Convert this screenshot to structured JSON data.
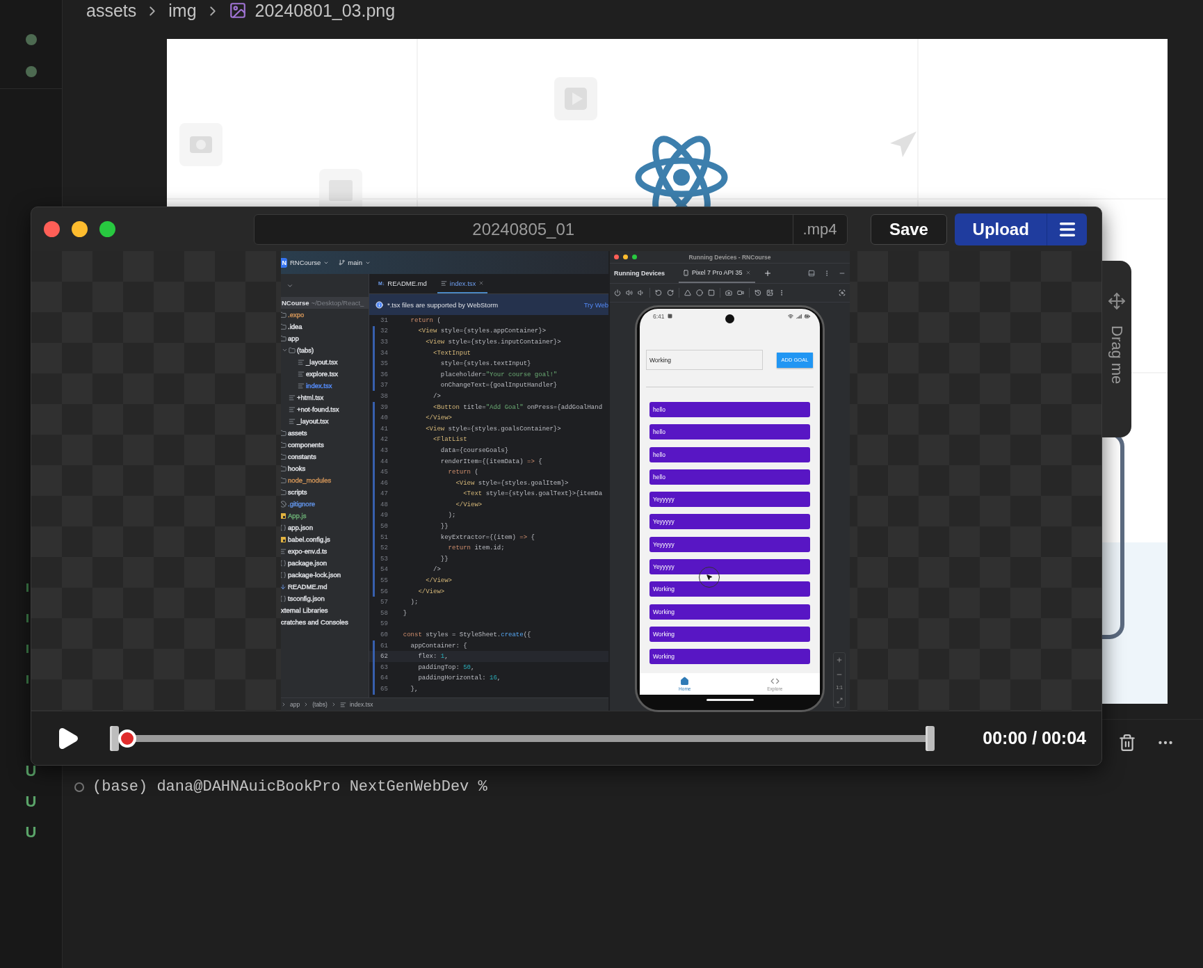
{
  "editor": {
    "breadcrumb": [
      "assets",
      "img",
      "20240801_03.png"
    ]
  },
  "gutter": {
    "badges": [
      "U",
      "U",
      "U"
    ]
  },
  "terminal": {
    "prompt": "(base) dana@DAHNAuicBookPro NextGenWebDev %"
  },
  "recorder": {
    "filename": "20240805_01",
    "extension": ".mp4",
    "save": "Save",
    "upload": "Upload",
    "drag_label": "Drag me",
    "playback": {
      "level": 0,
      "time": "00:00 / 00:04"
    },
    "frame": {
      "ide": {
        "project_badge": "N",
        "project": "RNCourse",
        "branch": "main",
        "tabs": [
          {
            "badge": "M↓",
            "label": "README.md",
            "selected": false
          },
          {
            "label": "index.tsx",
            "selected": true
          }
        ],
        "notice": "*.tsx files are supported by WebStorm",
        "notice_action": "Try Web",
        "tree_root": {
          "name": "NCourse",
          "path": "~/Desktop/React_"
        },
        "tree": [
          {
            "name": ".expo",
            "kind": "folder",
            "color": "#c98f56"
          },
          {
            "name": ".idea",
            "kind": "folder",
            "color": "#dfe1e5"
          },
          {
            "name": "app",
            "kind": "folder",
            "color": "#dfe1e5",
            "children": [
              {
                "name": "(tabs)",
                "kind": "folder",
                "color": "#dfe1e5",
                "expanded": true,
                "children": [
                  {
                    "name": "_layout.tsx",
                    "kind": "file",
                    "color": "#dfe1e5"
                  },
                  {
                    "name": "explore.tsx",
                    "kind": "file",
                    "color": "#dfe1e5"
                  },
                  {
                    "name": "index.tsx",
                    "kind": "file",
                    "color": "#548af7"
                  }
                ]
              },
              {
                "name": "+html.tsx",
                "kind": "file",
                "color": "#dfe1e5"
              },
              {
                "name": "+not-found.tsx",
                "kind": "file",
                "color": "#dfe1e5"
              },
              {
                "name": "_layout.tsx",
                "kind": "file",
                "color": "#dfe1e5"
              }
            ]
          },
          {
            "name": "assets",
            "kind": "folder",
            "color": "#dfe1e5"
          },
          {
            "name": "components",
            "kind": "folder",
            "color": "#dfe1e5"
          },
          {
            "name": "constants",
            "kind": "folder",
            "color": "#dfe1e5"
          },
          {
            "name": "hooks",
            "kind": "folder",
            "color": "#dfe1e5"
          },
          {
            "name": "node_modules",
            "kind": "folder",
            "color": "#c98f56"
          },
          {
            "name": "scripts",
            "kind": "folder",
            "color": "#dfe1e5"
          },
          {
            "name": ".gitignore",
            "kind": "ignore",
            "color": "#5f8fe0"
          },
          {
            "name": "App.js",
            "kind": "js",
            "color": "#6aab73"
          },
          {
            "name": "app.json",
            "kind": "json",
            "color": "#dfe1e5"
          },
          {
            "name": "babel.config.js",
            "kind": "js",
            "color": "#dfe1e5"
          },
          {
            "name": "expo-env.d.ts",
            "kind": "file",
            "color": "#dfe1e5"
          },
          {
            "name": "package.json",
            "kind": "json",
            "color": "#dfe1e5"
          },
          {
            "name": "package-lock.json",
            "kind": "json",
            "color": "#dfe1e5"
          },
          {
            "name": "README.md",
            "kind": "md",
            "color": "#dfe1e5"
          },
          {
            "name": "tsconfig.json",
            "kind": "json",
            "color": "#dfe1e5"
          },
          {
            "name": "xternal Libraries",
            "kind": "library",
            "color": "#dfe1e5"
          },
          {
            "name": "cratches and Consoles",
            "kind": "library",
            "color": "#dfe1e5"
          }
        ],
        "code": [
          {
            "number": "31",
            "changed": false,
            "current": false,
            "tokens": [
              {
                "kind": "keyword",
                "text": "    return"
              },
              {
                "kind": "plain",
                "text": " ("
              }
            ]
          },
          {
            "number": "32",
            "changed": true,
            "current": false,
            "tokens": [
              {
                "kind": "tag",
                "text": "      <View"
              },
              {
                "kind": "plain",
                "text": " style={styles.appContainer}>"
              }
            ]
          },
          {
            "number": "33",
            "changed": true,
            "current": false,
            "tokens": [
              {
                "kind": "tag",
                "text": "        <View"
              },
              {
                "kind": "plain",
                "text": " style={styles.inputContainer}>"
              }
            ]
          },
          {
            "number": "34",
            "changed": true,
            "current": false,
            "tokens": [
              {
                "kind": "tag",
                "text": "          <TextInput"
              }
            ]
          },
          {
            "number": "35",
            "changed": true,
            "current": false,
            "tokens": [
              {
                "kind": "plain",
                "text": "            style={styles.textInput}"
              }
            ]
          },
          {
            "number": "36",
            "changed": true,
            "current": false,
            "tokens": [
              {
                "kind": "plain",
                "text": "            placeholder="
              },
              {
                "kind": "string",
                "text": "\"Your course goal!\""
              }
            ]
          },
          {
            "number": "37",
            "changed": true,
            "current": false,
            "tokens": [
              {
                "kind": "plain",
                "text": "            onChangeText={goalInputHandler}"
              }
            ]
          },
          {
            "number": "38",
            "changed": false,
            "current": false,
            "tokens": [
              {
                "kind": "plain",
                "text": "          />"
              }
            ]
          },
          {
            "number": "39",
            "changed": true,
            "current": false,
            "tokens": [
              {
                "kind": "tag",
                "text": "          <Button"
              },
              {
                "kind": "plain",
                "text": " title="
              },
              {
                "kind": "string",
                "text": "\"Add Goal\""
              },
              {
                "kind": "plain",
                "text": " onPress={addGoalHand"
              }
            ]
          },
          {
            "number": "40",
            "changed": true,
            "current": false,
            "tokens": [
              {
                "kind": "tag",
                "text": "        </View>"
              }
            ]
          },
          {
            "number": "41",
            "changed": true,
            "current": false,
            "tokens": [
              {
                "kind": "tag",
                "text": "        <View"
              },
              {
                "kind": "plain",
                "text": " style={styles.goalsContainer}>"
              }
            ]
          },
          {
            "number": "42",
            "changed": true,
            "current": false,
            "tokens": [
              {
                "kind": "tag",
                "text": "          <FlatList"
              }
            ]
          },
          {
            "number": "43",
            "changed": true,
            "current": false,
            "tokens": [
              {
                "kind": "plain",
                "text": "            data={courseGoals}"
              }
            ]
          },
          {
            "number": "44",
            "changed": true,
            "current": false,
            "tokens": [
              {
                "kind": "plain",
                "text": "            renderItem={(itemData) "
              },
              {
                "kind": "keyword",
                "text": "=>"
              },
              {
                "kind": "plain",
                "text": " {"
              }
            ]
          },
          {
            "number": "45",
            "changed": true,
            "current": false,
            "tokens": [
              {
                "kind": "keyword",
                "text": "              return"
              },
              {
                "kind": "plain",
                "text": " ("
              }
            ]
          },
          {
            "number": "46",
            "changed": true,
            "current": false,
            "tokens": [
              {
                "kind": "tag",
                "text": "                <View"
              },
              {
                "kind": "plain",
                "text": " style={styles.goalItem}>"
              }
            ]
          },
          {
            "number": "47",
            "changed": true,
            "current": false,
            "tokens": [
              {
                "kind": "tag",
                "text": "                  <Text"
              },
              {
                "kind": "plain",
                "text": " style={styles.goalText}>{itemDa"
              }
            ]
          },
          {
            "number": "48",
            "changed": true,
            "current": false,
            "tokens": [
              {
                "kind": "tag",
                "text": "                </View>"
              }
            ]
          },
          {
            "number": "49",
            "changed": true,
            "current": false,
            "tokens": [
              {
                "kind": "plain",
                "text": "              );"
              }
            ]
          },
          {
            "number": "50",
            "changed": true,
            "current": false,
            "tokens": [
              {
                "kind": "plain",
                "text": "            }}"
              }
            ]
          },
          {
            "number": "51",
            "changed": true,
            "current": false,
            "tokens": [
              {
                "kind": "plain",
                "text": "            keyExtractor={(item) "
              },
              {
                "kind": "keyword",
                "text": "=>"
              },
              {
                "kind": "plain",
                "text": " {"
              }
            ]
          },
          {
            "number": "52",
            "changed": true,
            "current": false,
            "tokens": [
              {
                "kind": "keyword",
                "text": "              return"
              },
              {
                "kind": "plain",
                "text": " item.id;"
              }
            ]
          },
          {
            "number": "53",
            "changed": true,
            "current": false,
            "tokens": [
              {
                "kind": "plain",
                "text": "            }}"
              }
            ]
          },
          {
            "number": "54",
            "changed": true,
            "current": false,
            "tokens": [
              {
                "kind": "plain",
                "text": "          />"
              }
            ]
          },
          {
            "number": "55",
            "changed": true,
            "current": false,
            "tokens": [
              {
                "kind": "tag",
                "text": "        </View>"
              }
            ]
          },
          {
            "number": "56",
            "changed": true,
            "current": false,
            "tokens": [
              {
                "kind": "tag",
                "text": "      </View>"
              }
            ]
          },
          {
            "number": "57",
            "changed": false,
            "current": false,
            "tokens": [
              {
                "kind": "plain",
                "text": "    );"
              }
            ]
          },
          {
            "number": "58",
            "changed": false,
            "current": false,
            "tokens": [
              {
                "kind": "plain",
                "text": "  }"
              }
            ]
          },
          {
            "number": "59",
            "changed": false,
            "current": false
          },
          {
            "number": "60",
            "changed": false,
            "current": false,
            "tokens": [
              {
                "kind": "keyword",
                "text": "  const"
              },
              {
                "kind": "plain",
                "text": " styles = StyleSheet."
              },
              {
                "kind": "method",
                "text": "create"
              },
              {
                "kind": "plain",
                "text": "({"
              }
            ]
          },
          {
            "number": "61",
            "changed": true,
            "current": false,
            "tokens": [
              {
                "kind": "plain",
                "text": "    appContainer: {"
              }
            ]
          },
          {
            "number": "62",
            "changed": true,
            "current": true,
            "tokens": [
              {
                "kind": "plain",
                "text": "      flex: "
              },
              {
                "kind": "number",
                "text": "1"
              },
              {
                "kind": "plain",
                "text": ","
              }
            ]
          },
          {
            "number": "63",
            "changed": true,
            "current": false,
            "tokens": [
              {
                "kind": "plain",
                "text": "      paddingTop: "
              },
              {
                "kind": "number",
                "text": "50"
              },
              {
                "kind": "plain",
                "text": ","
              }
            ]
          },
          {
            "number": "64",
            "changed": true,
            "current": false,
            "tokens": [
              {
                "kind": "plain",
                "text": "      paddingHorizontal: "
              },
              {
                "kind": "number",
                "text": "16"
              },
              {
                "kind": "plain",
                "text": ","
              }
            ]
          },
          {
            "number": "65",
            "changed": true,
            "current": false,
            "tokens": [
              {
                "kind": "plain",
                "text": "    },"
              }
            ]
          }
        ],
        "path": [
          "app",
          "(tabs)",
          "index.tsx"
        ]
      },
      "devices": {
        "window_title": "Running Devices - RNCourse",
        "panel_title": "Running Devices",
        "device_tab": "Pixel 7 Pro API 35",
        "zoom_label": "1:1",
        "phone": {
          "time": "6:41",
          "input_value": "Working",
          "add_button": "ADD GOAL",
          "goals": [
            "hello",
            "hello",
            "hello",
            "hello",
            "Yeyyyyy",
            "Yeyyyyy",
            "Yeyyyyy",
            "Yeyyyyy",
            "Working",
            "Working",
            "Working",
            "Working"
          ],
          "nav": [
            {
              "label": "Home",
              "selected": true
            },
            {
              "label": "Explore",
              "selected": false
            }
          ]
        }
      }
    }
  }
}
